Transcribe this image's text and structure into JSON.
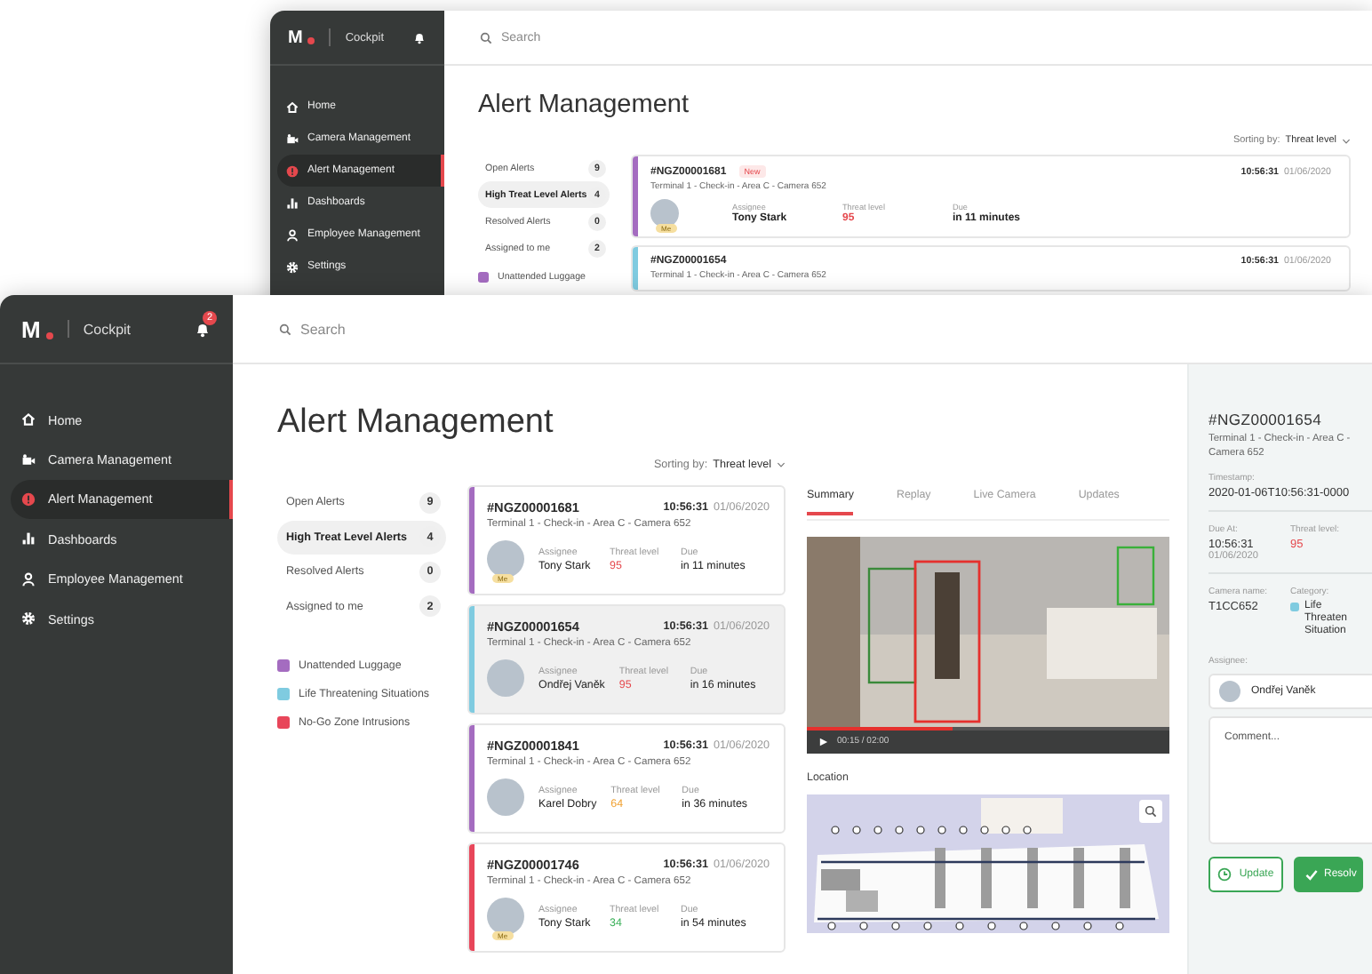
{
  "back_window": {
    "brand": {
      "logo": "M",
      "name": "Cockpit"
    },
    "sidebar": {
      "items": [
        {
          "label": "Home",
          "selected": false
        },
        {
          "label": "Camera Management",
          "selected": false
        },
        {
          "label": "Alert Management",
          "selected": true
        },
        {
          "label": "Dashboards",
          "selected": false
        },
        {
          "label": "Employee Management",
          "selected": false
        },
        {
          "label": "Settings",
          "selected": false
        }
      ]
    },
    "search": {
      "placeholder": "Search"
    },
    "title": "Alert Management",
    "sorting": {
      "label": "Sorting by:",
      "value": "Threat level"
    },
    "filters": [
      {
        "label": "Open Alerts",
        "count": "9",
        "selected": false
      },
      {
        "label": "High Treat Level Alerts",
        "count": "4",
        "selected": true
      },
      {
        "label": "Resolved Alerts",
        "count": "0",
        "selected": false
      },
      {
        "label": "Assigned to me",
        "count": "2",
        "selected": false
      }
    ],
    "legend": [
      {
        "label": "Unattended Luggage",
        "color": "#a46cc0"
      }
    ],
    "cards": [
      {
        "id": "#NGZ00001681",
        "badge": "New",
        "time": "10:56:31",
        "date": "01/06/2020",
        "subtitle": "Terminal 1 - Check-in - Area C - Camera 652",
        "color": "#a46cc0",
        "selected": false,
        "avatar_badge": "Me",
        "fields": [
          {
            "label": "Assignee",
            "value": "Tony Stark"
          },
          {
            "label": "Threat level",
            "value": "95",
            "color": "#e5484d"
          },
          {
            "label": "Due",
            "value": "in 11 minutes"
          }
        ]
      },
      {
        "id": "#NGZ00001654",
        "time": "10:56:31",
        "date": "01/06/2020",
        "subtitle": "Terminal 1 - Check-in - Area C - Camera 652",
        "color": "#7fcbe0",
        "selected": false
      }
    ]
  },
  "front_window": {
    "brand": {
      "logo": "M",
      "name": "Cockpit"
    },
    "notification_count": "2",
    "sidebar": {
      "items": [
        {
          "label": "Home",
          "selected": false
        },
        {
          "label": "Camera Management",
          "selected": false
        },
        {
          "label": "Alert Management",
          "selected": true
        },
        {
          "label": "Dashboards",
          "selected": false
        },
        {
          "label": "Employee Management",
          "selected": false
        },
        {
          "label": "Settings",
          "selected": false
        }
      ]
    },
    "search": {
      "placeholder": "Search"
    },
    "title": "Alert Management",
    "sorting": {
      "label": "Sorting by:",
      "value": "Threat level"
    },
    "filters": [
      {
        "label": "Open Alerts",
        "count": "9",
        "selected": false
      },
      {
        "label": "High Treat Level Alerts",
        "count": "4",
        "selected": true
      },
      {
        "label": "Resolved Alerts",
        "count": "0",
        "selected": false
      },
      {
        "label": "Assigned to me",
        "count": "2",
        "selected": false
      }
    ],
    "legend": [
      {
        "label": "Unattended Luggage",
        "color": "#a46cc0"
      },
      {
        "label": "Life Threatening Situations",
        "color": "#7fcbe0"
      },
      {
        "label": "No-Go Zone Intrusions",
        "color": "#e8465a"
      }
    ],
    "cards": [
      {
        "id": "#NGZ00001681",
        "time": "10:56:31",
        "date": "01/06/2020",
        "subtitle": "Terminal 1 - Check-in - Area C - Camera 652",
        "color": "#a46cc0",
        "selected": false,
        "avatar_badge": "Me",
        "fields": [
          {
            "label": "Assignee",
            "value": "Tony Stark"
          },
          {
            "label": "Threat level",
            "value": "95",
            "color": "#e5484d"
          },
          {
            "label": "Due",
            "value": "in 11 minutes"
          }
        ]
      },
      {
        "id": "#NGZ00001654",
        "time": "10:56:31",
        "date": "01/06/2020",
        "subtitle": "Terminal 1 - Check-in - Area C - Camera 652",
        "color": "#7fcbe0",
        "selected": true,
        "fields": [
          {
            "label": "Assignee",
            "value": "Ondřej Vaněk"
          },
          {
            "label": "Threat level",
            "value": "95",
            "color": "#e5484d"
          },
          {
            "label": "Due",
            "value": "in 16 minutes"
          }
        ]
      },
      {
        "id": "#NGZ00001841",
        "time": "10:56:31",
        "date": "01/06/2020",
        "subtitle": "Terminal 1 - Check-in - Area C - Camera 652",
        "color": "#a46cc0",
        "selected": false,
        "fields": [
          {
            "label": "Assignee",
            "value": "Karel Dobry"
          },
          {
            "label": "Threat level",
            "value": "64",
            "color": "#f0a030"
          },
          {
            "label": "Due",
            "value": "in 36 minutes"
          }
        ]
      },
      {
        "id": "#NGZ00001746",
        "time": "10:56:31",
        "date": "01/06/2020",
        "subtitle": "Terminal 1 - Check-in - Area C - Camera 652",
        "color": "#e8465a",
        "selected": false,
        "avatar_badge": "Me",
        "fields": [
          {
            "label": "Assignee",
            "value": "Tony Stark"
          },
          {
            "label": "Threat level",
            "value": "34",
            "color": "#3cb15a"
          },
          {
            "label": "Due",
            "value": "in 54 minutes"
          }
        ]
      }
    ],
    "tabs": [
      {
        "label": "Summary",
        "selected": true
      },
      {
        "label": "Replay",
        "selected": false
      },
      {
        "label": "Live Camera",
        "selected": false
      },
      {
        "label": "Updates",
        "selected": false
      }
    ],
    "video": {
      "time": "00:15 / 02:00",
      "level": 0.4
    },
    "location": {
      "label": "Location"
    },
    "detail_panel": {
      "id": "#NGZ00001654",
      "subtitle": "Terminal 1 - Check-in - Area C - Camera 652",
      "timestamp": {
        "label": "Timestamp:",
        "value": "2020-01-06T10:56:31-0000"
      },
      "due": {
        "label": "Due At:",
        "value": "10:56:31",
        "date": "01/06/2020"
      },
      "threat": {
        "label": "Threat level:",
        "value": "95",
        "color": "#e5484d"
      },
      "camera": {
        "label": "Camera name:",
        "value": "T1CC652"
      },
      "category": {
        "label": "Category:",
        "value": "Life Threaten Situation",
        "color": "#7fcbe0"
      },
      "assignee": {
        "label": "Assignee:",
        "name": "Ondřej Vaněk"
      },
      "comment": {
        "placeholder": "Comment..."
      },
      "buttons": [
        {
          "label": "Update",
          "kind": "secondary"
        },
        {
          "label": "Resolv",
          "kind": "primary"
        }
      ]
    }
  }
}
